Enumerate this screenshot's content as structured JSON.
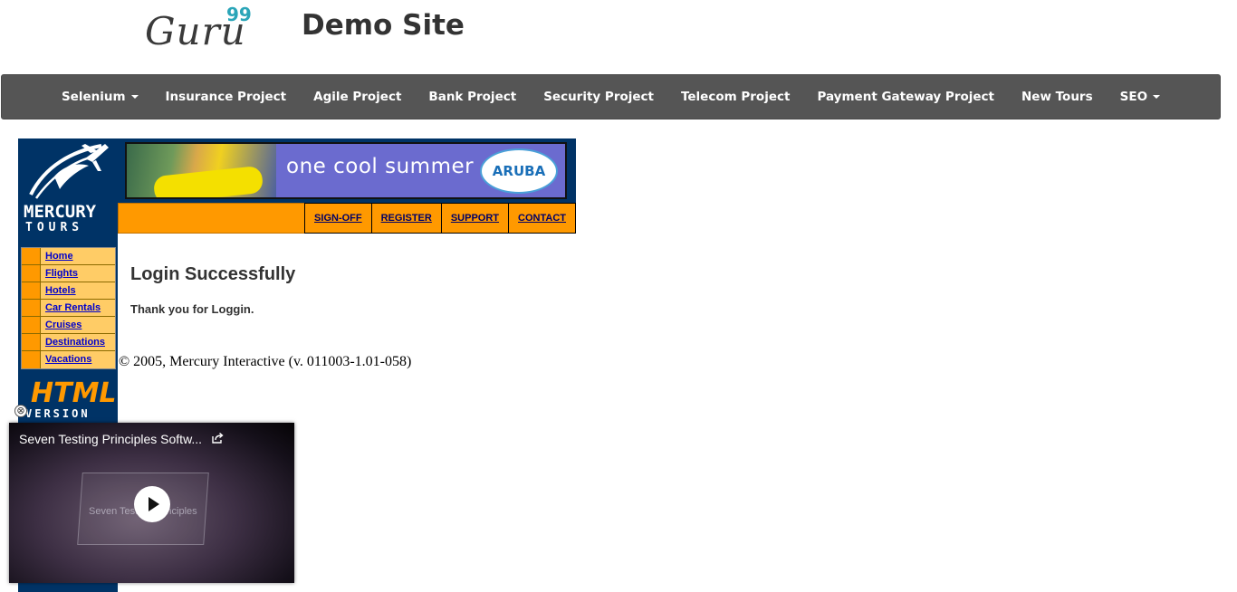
{
  "header": {
    "logo_text": "Guru",
    "logo_superscript": "99",
    "site_title": "Demo Site"
  },
  "navbar": {
    "items": [
      {
        "label": "Selenium",
        "dropdown": true
      },
      {
        "label": "Insurance Project",
        "dropdown": false
      },
      {
        "label": "Agile Project",
        "dropdown": false
      },
      {
        "label": "Bank Project",
        "dropdown": false
      },
      {
        "label": "Security Project",
        "dropdown": false
      },
      {
        "label": "Telecom Project",
        "dropdown": false
      },
      {
        "label": "Payment Gateway Project",
        "dropdown": false
      },
      {
        "label": "New Tours",
        "dropdown": false
      },
      {
        "label": "SEO",
        "dropdown": true
      }
    ]
  },
  "mercury": {
    "logo_line1": "MERCURY",
    "logo_line2": "TOURS",
    "side_menu": [
      "Home",
      "Flights",
      "Hotels",
      "Car Rentals",
      "Cruises",
      "Destinations",
      "Vacations"
    ],
    "badge_main": "HTML",
    "badge_sub": "VERSION"
  },
  "banner": {
    "text": "one cool summer",
    "badge": "ARUBA"
  },
  "top_links": [
    "SIGN-OFF",
    "REGISTER",
    "SUPPORT",
    "CONTACT"
  ],
  "content": {
    "title": "Login Successfully",
    "message": "Thank you for Loggin.",
    "copyright": "© 2005, Mercury Interactive (v. 011003-1.01-058)"
  },
  "video": {
    "title": "Seven Testing Principles Softw...",
    "overlay_text": "Seven Testing Principles",
    "close_glyph": "⊗"
  },
  "colors": {
    "navbar_bg": "#555555",
    "mercury_navy": "#003366",
    "mercury_orange": "#ff9900",
    "menu_yellow": "#ffcc66",
    "banner_purple": "#6b6bcf",
    "logo_accent": "#2aa5b8"
  }
}
